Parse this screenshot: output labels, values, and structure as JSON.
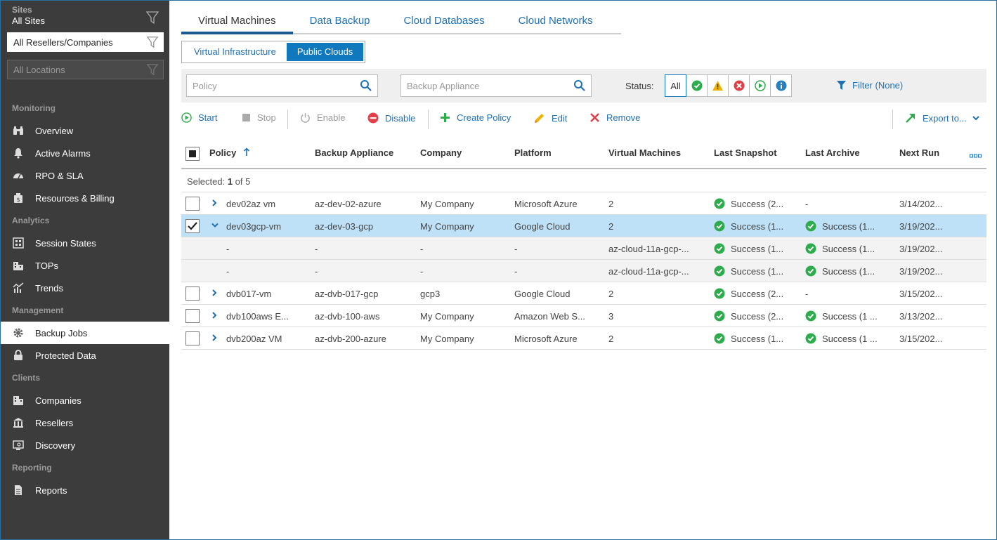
{
  "sidebar": {
    "sites_label": "Sites",
    "sites_value": "All Sites",
    "resellers_select": "All Resellers/Companies",
    "locations_select": "All Locations",
    "sections": {
      "monitoring": "Monitoring",
      "analytics": "Analytics",
      "management": "Management",
      "clients": "Clients",
      "reporting": "Reporting"
    },
    "items": {
      "overview": "Overview",
      "active_alarms": "Active Alarms",
      "rpo_sla": "RPO & SLA",
      "resources_billing": "Resources & Billing",
      "session_states": "Session States",
      "tops": "TOPs",
      "trends": "Trends",
      "backup_jobs": "Backup Jobs",
      "protected_data": "Protected Data",
      "companies": "Companies",
      "resellers": "Resellers",
      "discovery": "Discovery",
      "reports": "Reports"
    }
  },
  "tabs": [
    "Virtual Machines",
    "Data Backup",
    "Cloud Databases",
    "Cloud Networks"
  ],
  "subtabs": [
    "Virtual Infrastructure",
    "Public Clouds"
  ],
  "filters": {
    "policy_placeholder": "Policy",
    "appliance_placeholder": "Backup Appliance",
    "status_label": "Status:",
    "status_all": "All",
    "filter_link": "Filter (None)"
  },
  "toolbar": {
    "start": "Start",
    "stop": "Stop",
    "enable": "Enable",
    "disable": "Disable",
    "create_policy": "Create Policy",
    "edit": "Edit",
    "remove": "Remove",
    "export": "Export to..."
  },
  "table": {
    "headers": [
      "Policy",
      "Backup Appliance",
      "Company",
      "Platform",
      "Virtual Machines",
      "Last Snapshot",
      "Last Archive",
      "Next Run"
    ],
    "selected_prefix": "Selected: ",
    "selected_count": "1",
    "selected_suffix": " of 5",
    "rows": [
      {
        "policy": "dev02az vm",
        "appliance": "az-dev-02-azure",
        "company": "My Company",
        "platform": "Microsoft Azure",
        "vms": "2",
        "snapshot": "Success (2...",
        "archive": "-",
        "next_run": "3/14/202..."
      },
      {
        "policy": "dev03gcp-vm",
        "appliance": "az-dev-03-gcp",
        "company": "My Company",
        "platform": "Google Cloud",
        "vms": "2",
        "snapshot": "Success (1...",
        "archive": "Success (1...",
        "next_run": "3/19/202..."
      },
      {
        "policy": "-",
        "appliance": "-",
        "company": "-",
        "platform": "-",
        "vms": "az-cloud-11a-gcp-...",
        "snapshot": "Success (1...",
        "archive": "Success (1...",
        "next_run": "3/19/202..."
      },
      {
        "policy": "-",
        "appliance": "-",
        "company": "-",
        "platform": "-",
        "vms": "az-cloud-11a-gcp-...",
        "snapshot": "Success (1...",
        "archive": "Success (1...",
        "next_run": "3/19/202..."
      },
      {
        "policy": "dvb017-vm",
        "appliance": "az-dvb-017-gcp",
        "company": "gcp3",
        "platform": "Google Cloud",
        "vms": "2",
        "snapshot": "Success (2...",
        "archive": "-",
        "next_run": "3/15/202..."
      },
      {
        "policy": "dvb100aws E...",
        "appliance": "az-dvb-100-aws",
        "company": "My Company",
        "platform": "Amazon Web S...",
        "vms": "3",
        "snapshot": "Success (2...",
        "archive": "Success (1 ...",
        "next_run": "3/13/202..."
      },
      {
        "policy": "dvb200az VM",
        "appliance": "az-dvb-200-azure",
        "company": "My Company",
        "platform": "Microsoft Azure",
        "vms": "2",
        "snapshot": "Success (1...",
        "archive": "Success (1 ...",
        "next_run": "3/15/202..."
      }
    ]
  },
  "colors": {
    "accent": "#1078bd",
    "link": "#1e6fb4",
    "sidebar": "#3c3c3c",
    "success": "#2eab4b",
    "warning": "#f0b400",
    "error": "#e0404a",
    "info": "#2a7fc1",
    "selected_row": "#bfe1f7"
  }
}
